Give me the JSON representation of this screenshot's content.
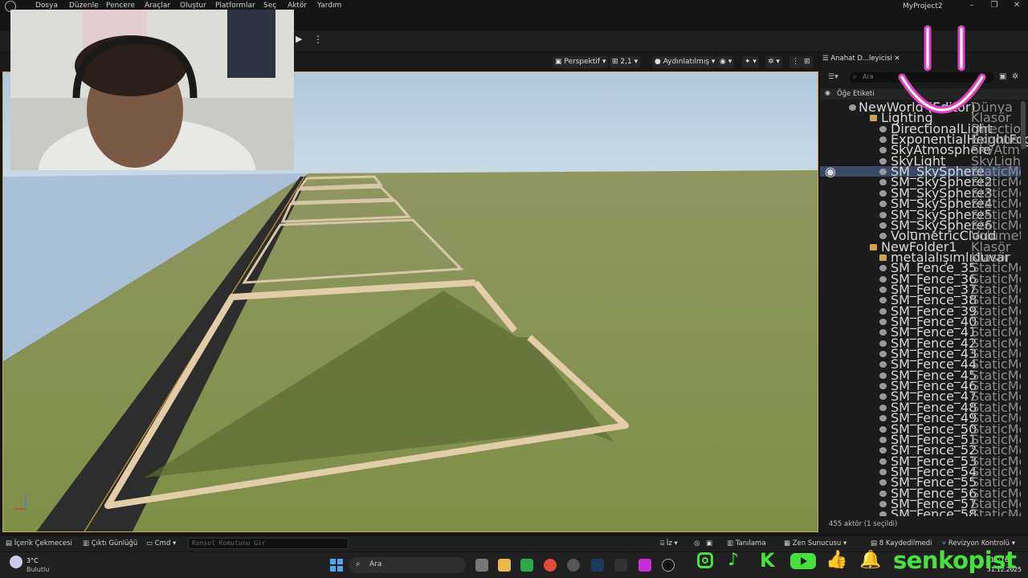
{
  "menubar": {
    "items": [
      "Dosya",
      "Düzenle",
      "Pencere",
      "Araçlar",
      "Oluştur",
      "Platformlar",
      "Seç",
      "Aktör",
      "Yardım"
    ],
    "project_title": "MyProject2",
    "window_buttons": [
      "–",
      "❐",
      "✕"
    ]
  },
  "toolbar": {
    "play": "▶",
    "more": "⋮"
  },
  "viewport": {
    "view_mode": "Perspektif",
    "lit_mode": "Aydınlatılmış",
    "grid_value": "2,1"
  },
  "outliner": {
    "tab_title": "Anahat D...leyicisi",
    "search_placeholder": "Ara",
    "column_label": "Öğe Etiketi",
    "footer": "455 aktör (1 seçildi)",
    "rows": [
      {
        "name": "NewWorld (Editor)",
        "type": "Dünya",
        "indent": 0
      },
      {
        "name": "Lighting",
        "type": "Klasör",
        "indent": 1
      },
      {
        "name": "DirectionalLight",
        "type": "DirectionalLight",
        "indent": 2
      },
      {
        "name": "ExponentialHeightFog",
        "type": "ExponentialHeightFog",
        "indent": 2
      },
      {
        "name": "SkyAtmosphere",
        "type": "SkyAtmosphere",
        "indent": 2
      },
      {
        "name": "SkyLight",
        "type": "SkyLight",
        "indent": 2
      },
      {
        "name": "SM_SkySphere",
        "type": "StaticMeshActor",
        "indent": 2,
        "selected": true
      },
      {
        "name": "SM_SkySphere2",
        "type": "StaticMeshActor",
        "indent": 2
      },
      {
        "name": "SM_SkySphere3",
        "type": "StaticMeshActor",
        "indent": 2
      },
      {
        "name": "SM_SkySphere4",
        "type": "StaticMeshActor",
        "indent": 2
      },
      {
        "name": "SM_SkySphere5",
        "type": "StaticMeshActor",
        "indent": 2
      },
      {
        "name": "SM_SkySphere6",
        "type": "StaticMeshActor",
        "indent": 2
      },
      {
        "name": "VolumetricCloud",
        "type": "VolumetricCloud",
        "indent": 2
      },
      {
        "name": "NewFolder1",
        "type": "Klasör",
        "indent": 1
      },
      {
        "name": "metalalışımlıduvar",
        "type": "Klasör",
        "indent": 2
      },
      {
        "name": "SM_Fence_35",
        "type": "StaticMeshActor",
        "indent": 2
      },
      {
        "name": "SM_Fence_36",
        "type": "StaticMeshActor",
        "indent": 2
      },
      {
        "name": "SM_Fence_37",
        "type": "StaticMeshActor",
        "indent": 2
      },
      {
        "name": "SM_Fence_38",
        "type": "StaticMeshActor",
        "indent": 2
      },
      {
        "name": "SM_Fence_39",
        "type": "StaticMeshActor",
        "indent": 2
      },
      {
        "name": "SM_Fence_40",
        "type": "StaticMeshActor",
        "indent": 2
      },
      {
        "name": "SM_Fence_41",
        "type": "StaticMeshActor",
        "indent": 2
      },
      {
        "name": "SM_Fence_42",
        "type": "StaticMeshActor",
        "indent": 2
      },
      {
        "name": "SM_Fence_43",
        "type": "StaticMeshActor",
        "indent": 2
      },
      {
        "name": "SM_Fence_44",
        "type": "StaticMeshActor",
        "indent": 2
      },
      {
        "name": "SM_Fence_45",
        "type": "StaticMeshActor",
        "indent": 2
      },
      {
        "name": "SM_Fence_46",
        "type": "StaticMeshActor",
        "indent": 2
      },
      {
        "name": "SM_Fence_47",
        "type": "StaticMeshActor",
        "indent": 2
      },
      {
        "name": "SM_Fence_48",
        "type": "StaticMeshActor",
        "indent": 2
      },
      {
        "name": "SM_Fence_49",
        "type": "StaticMeshActor",
        "indent": 2
      },
      {
        "name": "SM_Fence_50",
        "type": "StaticMeshActor",
        "indent": 2
      },
      {
        "name": "SM_Fence_51",
        "type": "StaticMeshActor",
        "indent": 2
      },
      {
        "name": "SM_Fence_52",
        "type": "StaticMeshActor",
        "indent": 2
      },
      {
        "name": "SM_Fence_53",
        "type": "StaticMeshActor",
        "indent": 2
      },
      {
        "name": "SM_Fence_54",
        "type": "StaticMeshActor",
        "indent": 2
      },
      {
        "name": "SM_Fence_55",
        "type": "StaticMeshActor",
        "indent": 2
      },
      {
        "name": "SM_Fence_56",
        "type": "StaticMeshActor",
        "indent": 2
      },
      {
        "name": "SM_Fence_57",
        "type": "StaticMeshActor",
        "indent": 2
      },
      {
        "name": "SM_Fence_58",
        "type": "StaticMeshActor",
        "indent": 2
      }
    ]
  },
  "bottombar": {
    "content_drawer": "İçerik Çekmecesi",
    "output_log": "Çıktı Günlüğü",
    "cmd": "Cmd",
    "console_placeholder": "Konsol Komutunu Gir",
    "trace": "İz",
    "derive": "Tanılama",
    "zen": "Zen Sunucusu",
    "unsaved": "8 Kaydedilmedi",
    "revision": "Revizyon Kontrolü"
  },
  "taskbar": {
    "weather_temp": "3°C",
    "weather_desc": "Bulutlu",
    "search_label": "Ara",
    "time": "11:16",
    "date": "31.12.2025"
  },
  "overlay": {
    "brand": "senkopist"
  },
  "colors": {
    "selected_row": "#3a4a66",
    "viewport_border": "#c9a84a",
    "brand_green": "#46e13c",
    "smile_pink": "#e040c8"
  }
}
